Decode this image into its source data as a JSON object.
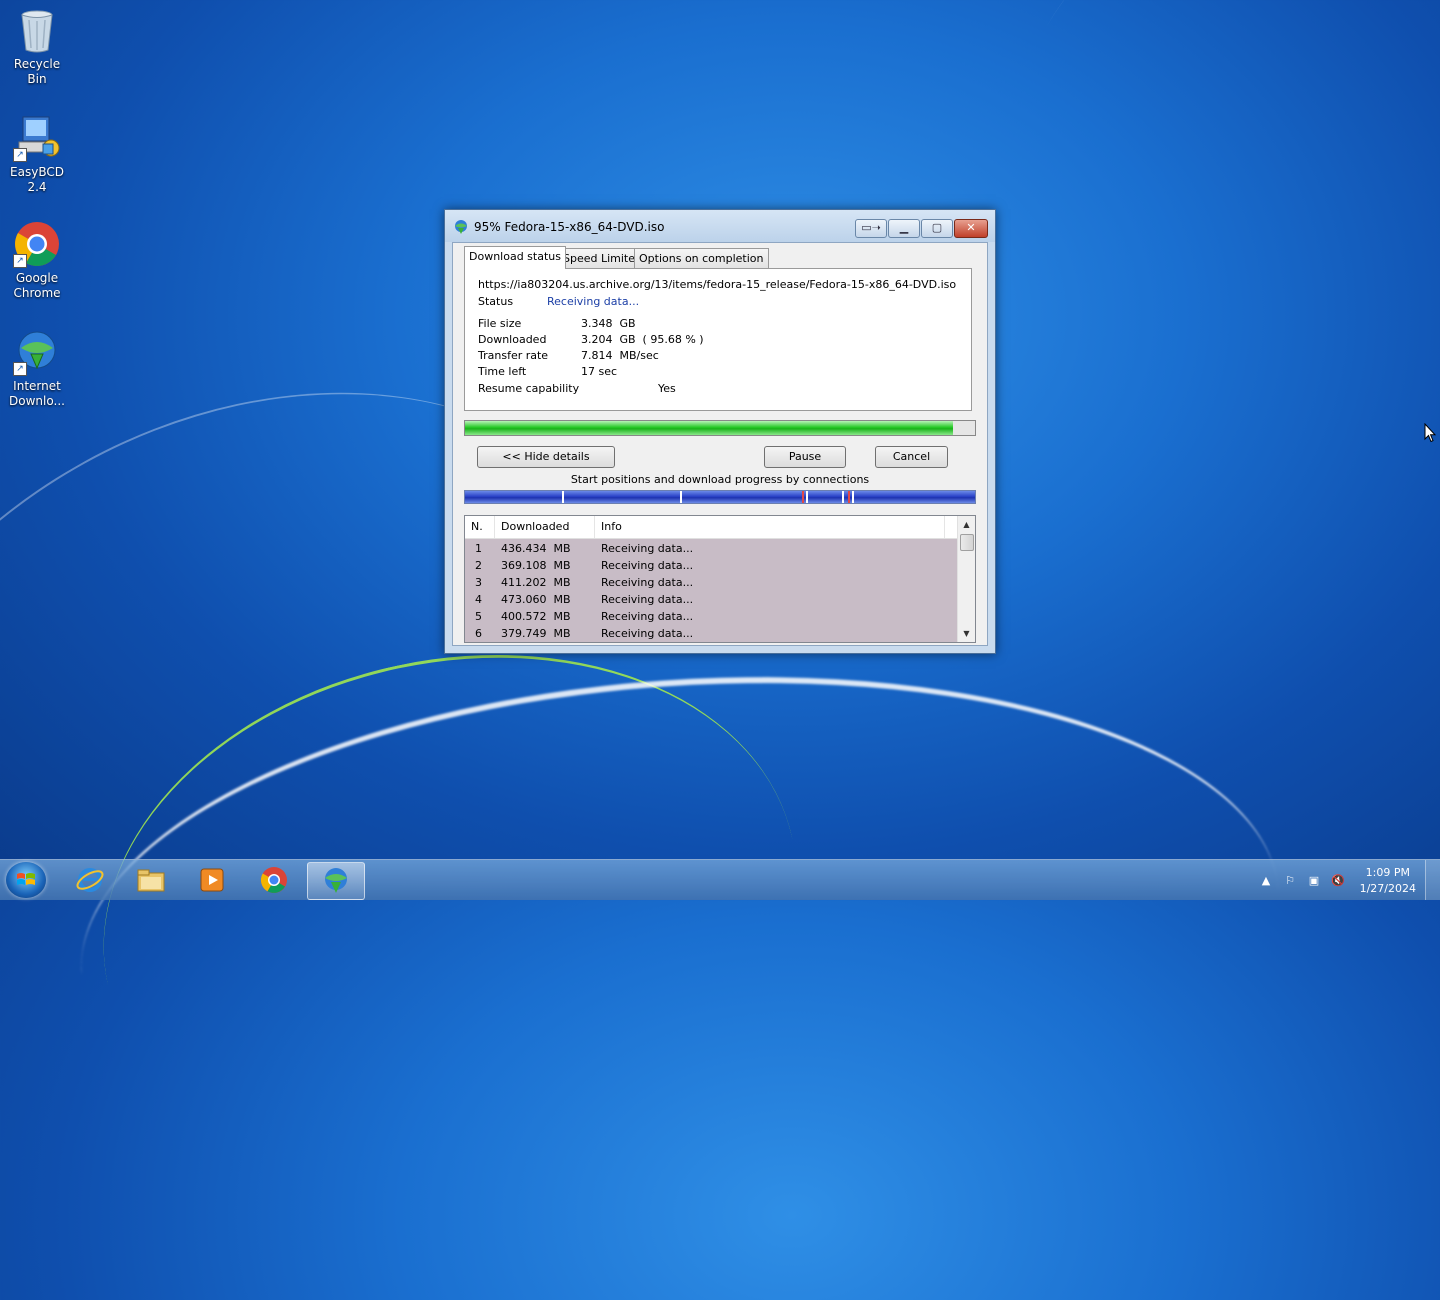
{
  "desktop": {
    "icons": [
      {
        "label": "Recycle Bin"
      },
      {
        "label": "EasyBCD 2.4"
      },
      {
        "label": "Google\nChrome"
      },
      {
        "label": "Internet\nDownlo..."
      }
    ]
  },
  "window": {
    "title": "95% Fedora-15-x86_64-DVD.iso",
    "tabs": [
      "Download status",
      "Speed Limiter",
      "Options on completion"
    ],
    "active_tab": "Download status",
    "url": "https://ia803204.us.archive.org/13/items/fedora-15_release/Fedora-15-x86_64-DVD.iso",
    "status_label": "Status",
    "status_value": "Receiving data...",
    "file_size_label": "File size",
    "file_size_value": "3.348  GB",
    "downloaded_label": "Downloaded",
    "downloaded_value": "3.204  GB  ( 95.68 % )",
    "transfer_rate_label": "Transfer rate",
    "transfer_rate_value": "7.814  MB/sec",
    "time_left_label": "Time left",
    "time_left_value": "17 sec",
    "resume_label": "Resume capability",
    "resume_value": "Yes",
    "progress_fraction": 0.9568,
    "hide_details_label": "<< Hide details",
    "pause_label": "Pause",
    "cancel_label": "Cancel",
    "connections_title": "Start positions and download progress by connections",
    "table": {
      "headers": [
        "N.",
        "Downloaded",
        "Info"
      ],
      "rows": [
        {
          "n": "1",
          "downloaded": "436.434  MB",
          "info": "Receiving data..."
        },
        {
          "n": "2",
          "downloaded": "369.108  MB",
          "info": "Receiving data..."
        },
        {
          "n": "3",
          "downloaded": "411.202  MB",
          "info": "Receiving data..."
        },
        {
          "n": "4",
          "downloaded": "473.060  MB",
          "info": "Receiving data..."
        },
        {
          "n": "5",
          "downloaded": "400.572  MB",
          "info": "Receiving data..."
        },
        {
          "n": "6",
          "downloaded": "379.749  MB",
          "info": "Receiving data..."
        }
      ]
    }
  },
  "taskbar": {
    "apps": [
      "internet-explorer",
      "windows-explorer",
      "media-player",
      "google-chrome",
      "internet-download-manager"
    ],
    "active_app": "internet-download-manager",
    "time": "1:09 PM",
    "date": "1/27/2024"
  },
  "colors": {
    "progress": "#22c322",
    "connection_bar": "#2b43c8",
    "row_highlight": "#c8bcc6"
  }
}
